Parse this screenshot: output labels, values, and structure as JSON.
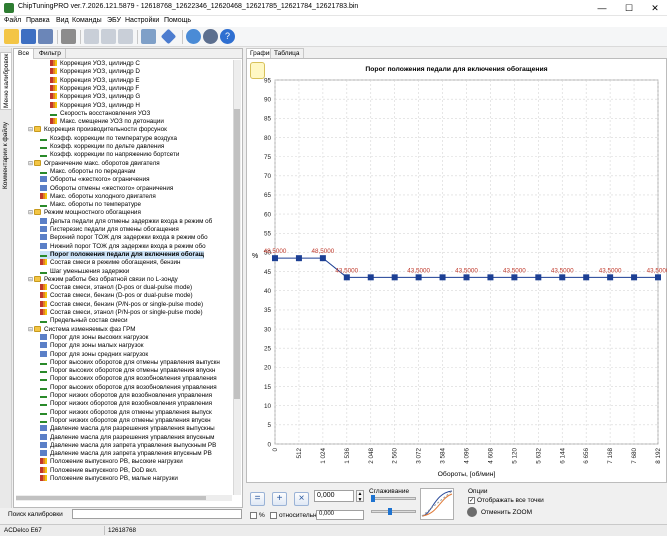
{
  "window": {
    "title": "ChipTuningPRO ver.7.2026.121.5879 - 12618768_12622346_12620468_12621785_12621784_12621783.bin",
    "minimize": "—",
    "maximize": "☐",
    "close": "✕"
  },
  "menu": [
    "Файл",
    "Правка",
    "Вид",
    "Команды",
    "ЭБУ",
    "Настройки",
    "Помощь"
  ],
  "left_vtabs": [
    "Меню калибровок",
    "Комментарии к файлу"
  ],
  "tree_tabs": [
    "Все",
    "Фильтр"
  ],
  "tree": [
    {
      "label": "Коррекция УОЗ, цилиндр C",
      "level": 3,
      "icon": "map"
    },
    {
      "label": "Коррекция УОЗ, цилиндр D",
      "level": 3,
      "icon": "map"
    },
    {
      "label": "Коррекция УОЗ, цилиндр E",
      "level": 3,
      "icon": "map"
    },
    {
      "label": "Коррекция УОЗ, цилиндр F",
      "level": 3,
      "icon": "map"
    },
    {
      "label": "Коррекция УОЗ, цилиндр G",
      "level": 3,
      "icon": "map"
    },
    {
      "label": "Коррекция УОЗ, цилиндр H",
      "level": 3,
      "icon": "map"
    },
    {
      "label": "Скорость восстановления УОЗ",
      "level": 3,
      "icon": "line"
    },
    {
      "label": "Макс. смещение УОЗ по детонации",
      "level": 3,
      "icon": "map"
    },
    {
      "label": "Коррекция производительности форсунок",
      "level": 1,
      "icon": "folder"
    },
    {
      "label": "Коэфф. коррекции по температуре воздуха",
      "level": 2,
      "icon": "line"
    },
    {
      "label": "Коэфф. коррекции по дельте давления",
      "level": 2,
      "icon": "line"
    },
    {
      "label": "Коэфф. коррекции по напряжению бортсети",
      "level": 2,
      "icon": "line"
    },
    {
      "label": "Ограничение макс. оборотов двигателя",
      "level": 1,
      "icon": "folder"
    },
    {
      "label": "Макс. обороты по передачам",
      "level": 2,
      "icon": "line"
    },
    {
      "label": "Обороты «жесткого» ограничения",
      "level": 2,
      "icon": "const"
    },
    {
      "label": "Обороты отмены «жесткого» ограничения",
      "level": 2,
      "icon": "const"
    },
    {
      "label": "Макс. обороты холодного двигателя",
      "level": 2,
      "icon": "map"
    },
    {
      "label": "Макс. обороты по температуре",
      "level": 2,
      "icon": "line"
    },
    {
      "label": "Режим мощностного обогащения",
      "level": 1,
      "icon": "folder"
    },
    {
      "label": "Дельта педали для отмены задержки входа в режим об",
      "level": 2,
      "icon": "const"
    },
    {
      "label": "Гистерезис педали для отмены обогащения",
      "level": 2,
      "icon": "const"
    },
    {
      "label": "Верхний порог TOЖ для задержки входа в режим обо",
      "level": 2,
      "icon": "const"
    },
    {
      "label": "Нижний порог TOЖ для задержки входа в режим обо",
      "level": 2,
      "icon": "const"
    },
    {
      "label": "Порог положения педали для включения обогащ",
      "level": 2,
      "icon": "line",
      "selected": true
    },
    {
      "label": "Состав смеси в режиме обогащения, бензин",
      "level": 2,
      "icon": "map"
    },
    {
      "label": "Шаг уменьшения задержки",
      "level": 2,
      "icon": "line"
    },
    {
      "label": "Режим работы без обратной связи по L-зонду",
      "level": 1,
      "icon": "folder"
    },
    {
      "label": "Состав смеси, этанол (D-pos or dual-pulse mode)",
      "level": 2,
      "icon": "map"
    },
    {
      "label": "Состав смеси, бензин (D-pos or dual-pulse mode)",
      "level": 2,
      "icon": "map"
    },
    {
      "label": "Состав смеси, бензин (P/N-pos or single-pulse mode)",
      "level": 2,
      "icon": "map"
    },
    {
      "label": "Состав смеси, этанол (P/N-pos or single-pulse mode)",
      "level": 2,
      "icon": "map"
    },
    {
      "label": "Предельный состав смеси",
      "level": 2,
      "icon": "line"
    },
    {
      "label": "Система изменяемых фаз ГРМ",
      "level": 1,
      "icon": "folder"
    },
    {
      "label": "Порог для зоны высоких нагрузок",
      "level": 2,
      "icon": "const"
    },
    {
      "label": "Порог для зоны малых нагрузок",
      "level": 2,
      "icon": "const"
    },
    {
      "label": "Порог для зоны средних нагрузок",
      "level": 2,
      "icon": "const"
    },
    {
      "label": "Порог высоких оборотов для отмены управления выпускн",
      "level": 2,
      "icon": "line"
    },
    {
      "label": "Порог высоких оборотов для отмены управления впускн",
      "level": 2,
      "icon": "line"
    },
    {
      "label": "Порог высоких оборотов для возобновления управления",
      "level": 2,
      "icon": "line"
    },
    {
      "label": "Порог высоких оборотов для возобновления управления",
      "level": 2,
      "icon": "line"
    },
    {
      "label": "Порог низких оборотов для возобновления управления",
      "level": 2,
      "icon": "line"
    },
    {
      "label": "Порог низких оборотов для возобновления управления",
      "level": 2,
      "icon": "line"
    },
    {
      "label": "Порог низких оборотов для отмены управления выпуск",
      "level": 2,
      "icon": "line"
    },
    {
      "label": "Порог низких оборотов для отмены управления впускн",
      "level": 2,
      "icon": "line"
    },
    {
      "label": "Давление масла для разрешения управления выпускны",
      "level": 2,
      "icon": "const"
    },
    {
      "label": "Давление масла для разрешения управления впускным",
      "level": 2,
      "icon": "const"
    },
    {
      "label": "Давление масла для запрета управления выпускным PB",
      "level": 2,
      "icon": "const"
    },
    {
      "label": "Давление масла для запрета управления впускным PB",
      "level": 2,
      "icon": "const"
    },
    {
      "label": "Положение выпускного PB, высокие нагрузки",
      "level": 2,
      "icon": "map"
    },
    {
      "label": "Положение выпускного PB, DoD вкл.",
      "level": 2,
      "icon": "map"
    },
    {
      "label": "Положение выпускного PB, малые нагрузки",
      "level": 2,
      "icon": "map"
    }
  ],
  "search_label": "Поиск калибровки",
  "search_value": "",
  "right_tabs": [
    "График",
    "Таблица"
  ],
  "chart_data": {
    "type": "line",
    "title": "Порог положения педали для включения обогащения",
    "xlabel": "Обороты, [об/мин]",
    "ylabel": "%",
    "x": [
      0,
      512,
      1024,
      1536,
      2048,
      2560,
      3072,
      3584,
      4096,
      4608,
      5120,
      5632,
      6144,
      6656,
      7168,
      7680,
      8192
    ],
    "x_tick_labels": [
      "0",
      "512",
      "1 024",
      "1 536",
      "2 048",
      "2 560",
      "3 072",
      "3 584",
      "4 096",
      "4 608",
      "5 120",
      "5 632",
      "6 144",
      "6 656",
      "7 168",
      "7 680",
      "8 192"
    ],
    "values": [
      48.5,
      48.5,
      48.5,
      43.5,
      43.5,
      43.5,
      43.5,
      43.5,
      43.5,
      43.5,
      43.5,
      43.5,
      43.5,
      43.5,
      43.5,
      43.5,
      43.5
    ],
    "point_labels": [
      "48,5000",
      "",
      "48,5000",
      "43,5000",
      "",
      "",
      "43,5000",
      "",
      "43,5000",
      "",
      "43,5000",
      "",
      "43,5000",
      "",
      "43,5000",
      "",
      "43,5000"
    ],
    "xlim": [
      0,
      8192
    ],
    "ylim": [
      0,
      95
    ],
    "y_ticks": [
      0,
      5,
      10,
      15,
      20,
      25,
      30,
      35,
      40,
      45,
      50,
      55,
      60,
      65,
      70,
      75,
      80,
      85,
      90,
      95
    ],
    "grid": true,
    "line_color": "#1c3f94"
  },
  "controls": {
    "step_value": "0,000",
    "percent_label": "%",
    "relative_label": "относительно",
    "relative_value": "0,000",
    "smoothing_label": "Сглаживание",
    "options_label": "Опции",
    "show_all_points": "Отображать все точки",
    "reset_zoom": "Отменить ZOOM"
  },
  "status": {
    "ecu": "ACDelco E67",
    "id": "12618768"
  }
}
